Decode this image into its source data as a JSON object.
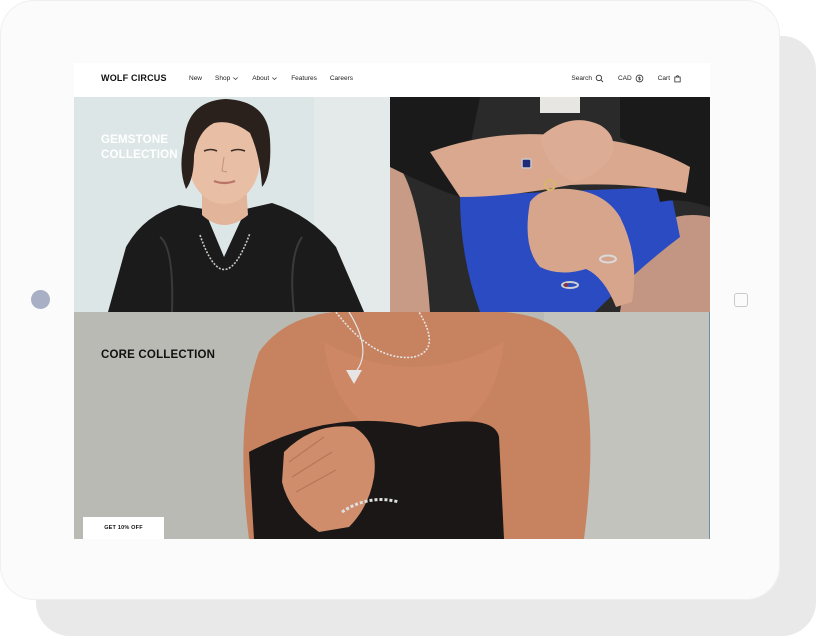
{
  "nav": {
    "logo": "WOLF CIRCUS",
    "menu": [
      {
        "label": "New"
      },
      {
        "label": "Shop"
      },
      {
        "label": "About"
      },
      {
        "label": "Features"
      },
      {
        "label": "Careers"
      }
    ],
    "search_label": "Search",
    "currency_label": "CAD",
    "cart_label": "Cart"
  },
  "hero": {
    "gemstone_title": "GEMSTONE COLLECTION",
    "core_title": "CORE COLLECTION"
  },
  "promo": {
    "label": "GET 10% OFF"
  },
  "colors": {
    "device": "#fbfbfb",
    "device_shadow": "#e9e9ea",
    "camera": "#a9afc4",
    "left_panel_bg": "#dfe6e7",
    "bottom_panel_bg": "#b8b9b2"
  }
}
